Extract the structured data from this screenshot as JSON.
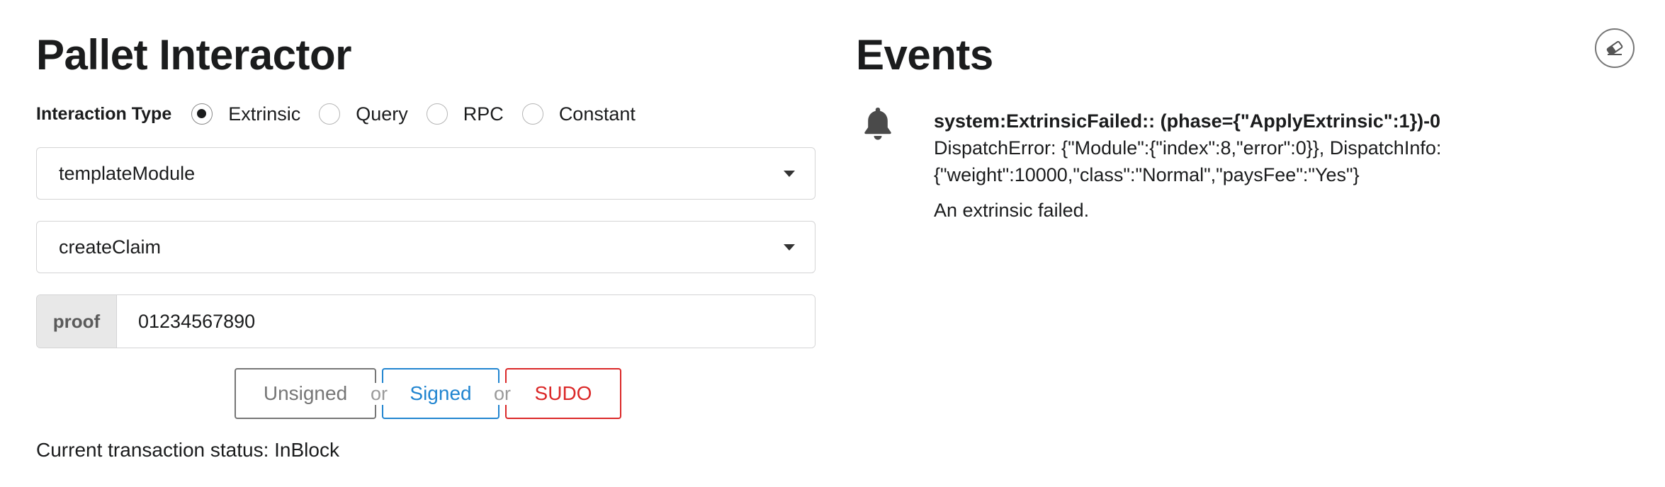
{
  "pallet": {
    "title": "Pallet Interactor",
    "interaction_type_label": "Interaction Type",
    "interaction_types": [
      {
        "label": "Extrinsic",
        "checked": true
      },
      {
        "label": "Query",
        "checked": false
      },
      {
        "label": "RPC",
        "checked": false
      },
      {
        "label": "Constant",
        "checked": false
      }
    ],
    "module_select": {
      "value": "templateModule"
    },
    "callable_select": {
      "value": "createClaim"
    },
    "param": {
      "label": "proof",
      "value": "01234567890"
    },
    "buttons": {
      "unsigned": "Unsigned",
      "or1": "or",
      "signed": "Signed",
      "or2": "or",
      "sudo": "SUDO"
    },
    "status": "Current transaction status: InBlock"
  },
  "events": {
    "title": "Events",
    "clear_icon": "eraser-icon",
    "items": [
      {
        "icon": "bell-icon",
        "header": "system:ExtrinsicFailed:: (phase={\"ApplyExtrinsic\":1})-0",
        "detail_line1": "DispatchError: {\"Module\":{\"index\":8,\"error\":0}}, DispatchInfo:",
        "detail_line2": "{\"weight\":10000,\"class\":\"Normal\",\"paysFee\":\"Yes\"}",
        "description": "An extrinsic failed."
      }
    ]
  },
  "colors": {
    "signed": "#2185d0",
    "sudo": "#db2828",
    "unsigned": "#767676",
    "border": "#d4d4d5",
    "label_bg": "#e8e8e8"
  }
}
